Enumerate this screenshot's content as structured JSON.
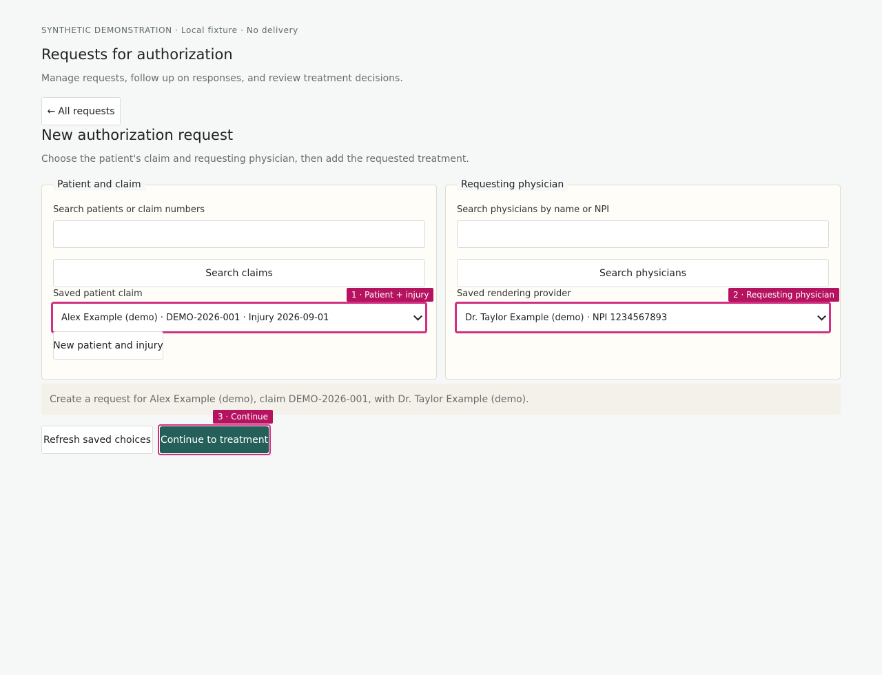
{
  "header": {
    "eyebrow": "SYNTHETIC DEMONSTRATION · Local fixture · No delivery",
    "title": "Requests for authorization",
    "subtitle": "Manage requests, follow up on responses, and review treatment decisions.",
    "back_arrow": "←",
    "back_label": "All requests"
  },
  "form": {
    "title": "New authorization request",
    "subtitle": "Choose the patient's claim and requesting physician, then add the requested treatment."
  },
  "patient_panel": {
    "legend": "Patient and claim",
    "search_label": "Search patients or claim numbers",
    "search_value": "",
    "search_button": "Search claims",
    "saved_label": "Saved patient claim",
    "saved_value": "Alex Example (demo) · DEMO-2026-001 · Injury 2026-09-01",
    "step_tag": "1 · Patient + injury",
    "new_button": "New patient and injury"
  },
  "physician_panel": {
    "legend": "Requesting physician",
    "search_label": "Search physicians by name or NPI",
    "search_value": "",
    "search_button": "Search physicians",
    "saved_label": "Saved rendering provider",
    "saved_value": "Dr. Taylor Example (demo) · NPI 1234567893",
    "step_tag": "2 · Requesting physician"
  },
  "summary": {
    "text": "Create a request for Alex Example (demo), claim DEMO-2026-001, with Dr. Taylor Example (demo)."
  },
  "actions": {
    "refresh_label": "Refresh saved choices",
    "continue_label": "Continue to treatment",
    "continue_tag": "3 · Continue"
  },
  "colors": {
    "background": "#f6f8f7",
    "panel": "#fffdf8",
    "highlight": "#d02f82",
    "tag": "#b5135f",
    "primary": "#245f5a"
  },
  "icons": {
    "back": "arrow-left-icon",
    "select": "chevron-down-icon"
  }
}
